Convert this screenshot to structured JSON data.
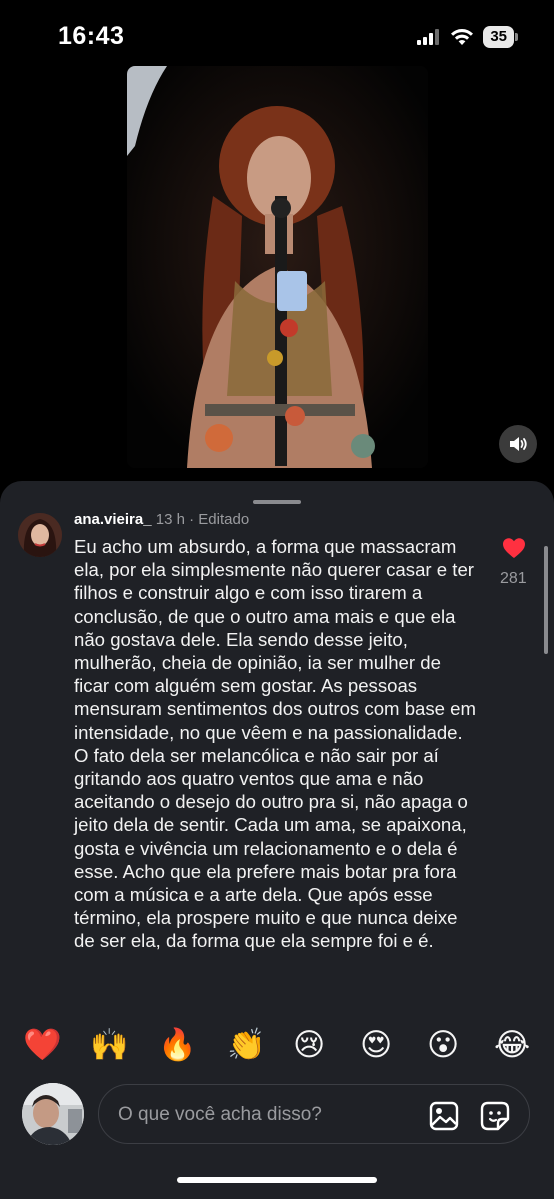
{
  "status": {
    "time": "16:43",
    "battery": "35"
  },
  "video": {
    "sound_icon": "speaker-icon"
  },
  "comment": {
    "username": "ana.vieira_",
    "time": "13 h",
    "separator": "·",
    "edited": "Editado",
    "text": "Eu acho um absurdo, a forma que massacram ela, por ela simplesmente não querer casar e ter filhos e construir algo e com isso tirarem a conclusão, de que o outro ama mais e que ela não gostava dele. Ela sendo desse jeito, mulherão, cheia de opinião, ia ser mulher de ficar com alguém sem gostar. As pessoas mensuram sentimentos dos outros com base em intensidade, no que vêem e na passionalidade. O fato dela ser melancólica e não sair por aí gritando aos quatro ventos que ama e não aceitando o desejo do outro pra si, não apaga o jeito dela de sentir. Cada um ama, se apaixona, gosta e vivência um relacionamento e o dela é esse. Acho que ela prefere mais botar pra fora com a música e a arte dela. Que após esse término, ela prospere muito e que nunca deixe de ser ela, da forma que ela sempre foi e é.",
    "likes": "281",
    "like_color": "#ff3040"
  },
  "reactions": [
    {
      "name": "red-heart",
      "glyph": "❤️"
    },
    {
      "name": "raising-hands",
      "glyph": "🙌"
    },
    {
      "name": "fire",
      "glyph": "🔥"
    },
    {
      "name": "clapping-hands",
      "glyph": "👏"
    },
    {
      "name": "crying-face",
      "glyph": "😢"
    },
    {
      "name": "heart-eyes",
      "glyph": "😍"
    },
    {
      "name": "astonished-face",
      "glyph": "😮"
    },
    {
      "name": "tears-of-joy",
      "glyph": "😂"
    }
  ],
  "composer": {
    "placeholder": "O que você acha disso?",
    "image_icon": "image-icon",
    "sticker_icon": "sticker-icon"
  }
}
